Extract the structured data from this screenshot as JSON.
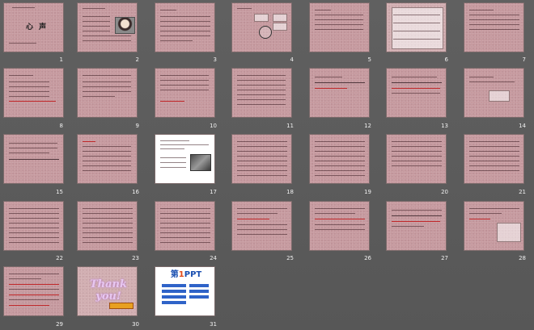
{
  "slides": [
    {
      "n": "1"
    },
    {
      "n": "2"
    },
    {
      "n": "3"
    },
    {
      "n": "4"
    },
    {
      "n": "5"
    },
    {
      "n": "6"
    },
    {
      "n": "7"
    },
    {
      "n": "8"
    },
    {
      "n": "9"
    },
    {
      "n": "10"
    },
    {
      "n": "11"
    },
    {
      "n": "12"
    },
    {
      "n": "13"
    },
    {
      "n": "14"
    },
    {
      "n": "15"
    },
    {
      "n": "16"
    },
    {
      "n": "17"
    },
    {
      "n": "18"
    },
    {
      "n": "19"
    },
    {
      "n": "20"
    },
    {
      "n": "21"
    },
    {
      "n": "22"
    },
    {
      "n": "23"
    },
    {
      "n": "24"
    },
    {
      "n": "25"
    },
    {
      "n": "26"
    },
    {
      "n": "27"
    },
    {
      "n": "28"
    },
    {
      "n": "29"
    },
    {
      "n": "30"
    },
    {
      "n": "31"
    }
  ],
  "slide1": {
    "title": "心 声"
  },
  "slide30": {
    "thank": "Thank you!"
  },
  "slide31": {
    "logo_main": "第",
    "logo_one": "1",
    "logo_rest": "PPT"
  },
  "colors": {
    "slide_bg": "#c69a9f",
    "window_bg": "#5b5b5b",
    "accent_red": "#c0282a"
  }
}
